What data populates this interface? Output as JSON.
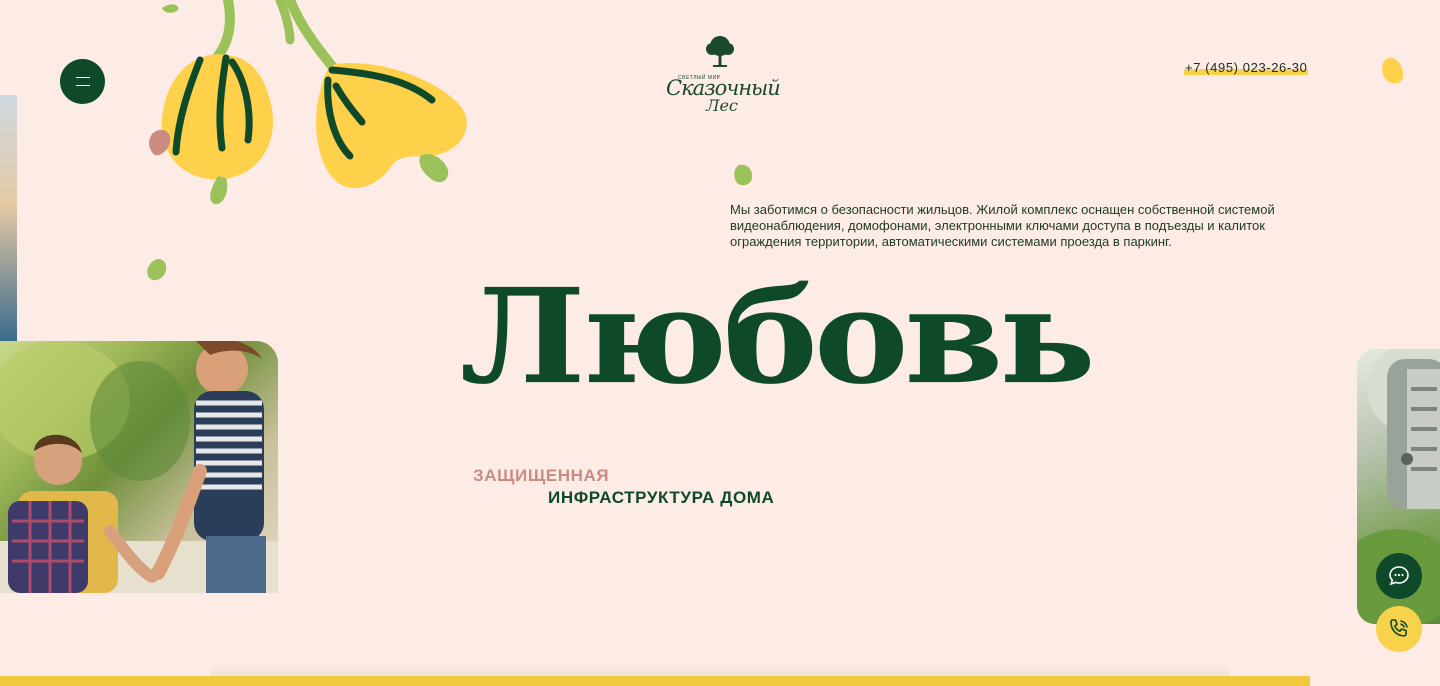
{
  "header": {
    "logo": {
      "tagline": "Светлый мир",
      "name_line1": "Сказочный",
      "name_line2": "Лес"
    },
    "phone": "+7 (495) 023-26-30"
  },
  "main": {
    "description": "Мы заботимся о безопасности жильцов. Жилой комплекс оснащен собственной системой видеонаблюдения, домофонами, электронными ключами доступа в подъезды и калиток ограждения территории, автоматическими системами проезда в паркинг.",
    "big_word": "Любовь",
    "subtitle_line1": "ЗАЩИЩЕННАЯ",
    "subtitle_line2": "ИНФРАСТРУКТУРА ДОМА"
  },
  "colors": {
    "background": "#fdece6",
    "brand_green": "#0e4a2a",
    "accent_yellow": "#f7d24a",
    "accent_pink": "#c98b82"
  },
  "icons": {
    "menu": "hamburger-icon",
    "chat": "chat-bubble-icon",
    "call": "phone-call-icon"
  }
}
